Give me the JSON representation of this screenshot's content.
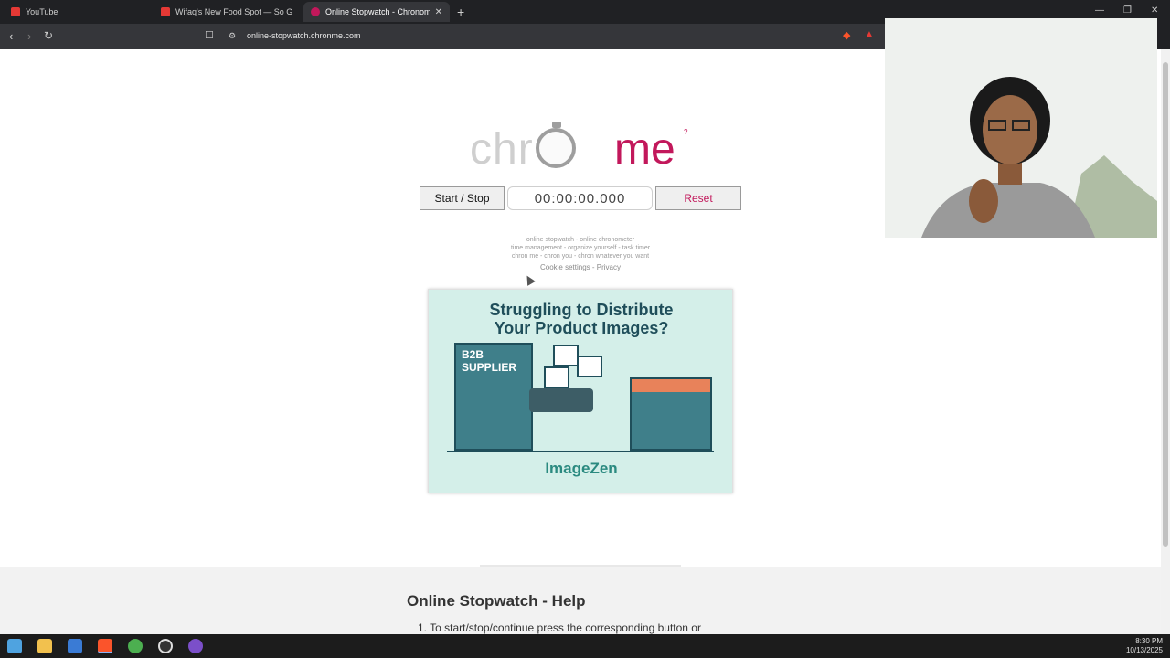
{
  "browser": {
    "tabs": [
      {
        "title": "YouTube",
        "favicon_color": "#e53935"
      },
      {
        "title": "Wifaq's New Food Spot — So Good!",
        "favicon_color": "#e53935"
      },
      {
        "title": "Online Stopwatch - Chronometer",
        "favicon_color": "#c2185b"
      }
    ],
    "url": "online-stopwatch.chronme.com",
    "new_tab_icon": "+"
  },
  "logo": {
    "left": "chr",
    "right": "me",
    "help_mark": "?"
  },
  "stopwatch": {
    "start_stop_label": "Start / Stop",
    "time": "00:00:00.000",
    "reset_label": "Reset"
  },
  "tagline": {
    "line1": "online stopwatch - online chronometer",
    "line2": "time management - organize yourself - task timer",
    "line3": "chron me - chron you - chron whatever you want"
  },
  "links": {
    "cookie": "Cookie settings",
    "sep": " - ",
    "privacy": "Privacy"
  },
  "ad": {
    "headline_1": "Struggling to Distribute",
    "headline_2": "Your Product Images?",
    "building_1": "B2B",
    "building_2": "SUPPLIER",
    "brand": "ImageZen"
  },
  "help": {
    "title": "Online Stopwatch - Help",
    "item1": "1. To start/stop/continue press the corresponding button or"
  },
  "system": {
    "time": "8:30 PM",
    "date": "10/13/2025"
  },
  "colors": {
    "accent": "#c2185b",
    "logo_gray": "#cfcfcf",
    "ad_bg": "#d4efe9"
  }
}
